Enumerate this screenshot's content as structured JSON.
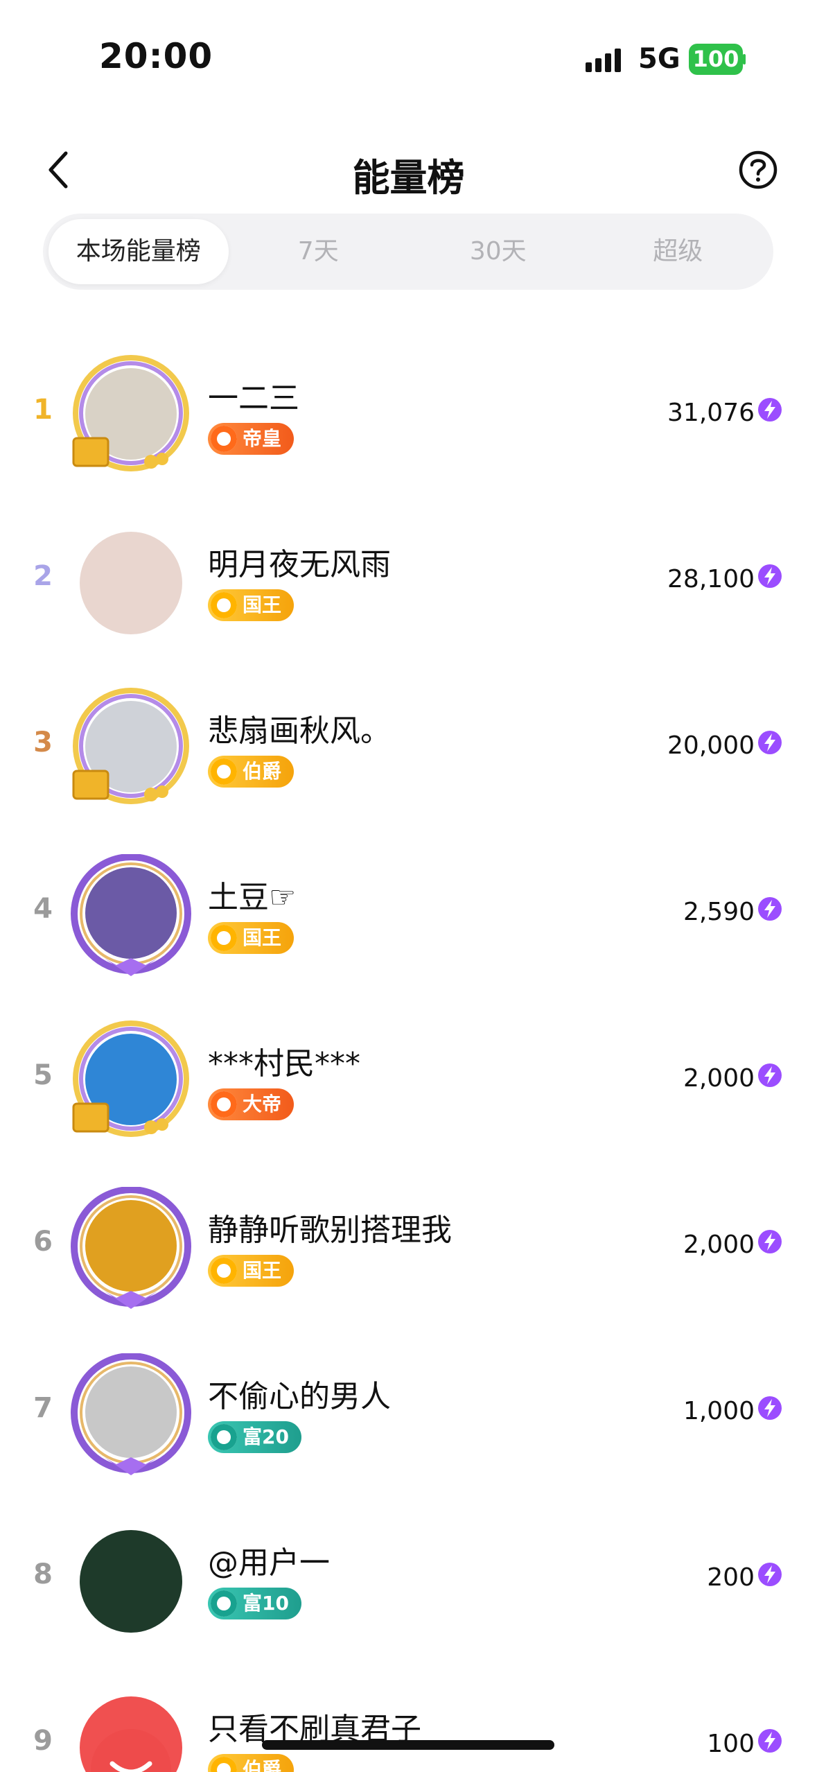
{
  "status_bar": {
    "time": "20:00",
    "network": "5G",
    "battery": "100"
  },
  "header": {
    "title": "能量榜",
    "back_icon": "chevron-left-icon",
    "help_icon": "question-circle-icon"
  },
  "tabs": [
    {
      "label": "本场能量榜",
      "active": true
    },
    {
      "label": "7天",
      "active": false
    },
    {
      "label": "30天",
      "active": false
    },
    {
      "label": "超级",
      "active": false
    }
  ],
  "colors": {
    "rank1": "#f0b429",
    "rank2": "#a9a4e8",
    "rank3": "#d48a4a",
    "rank_other": "#9b9b9b",
    "bolt": "#9b4dff",
    "tab_bg": "#f2f2f4"
  },
  "ranking": [
    {
      "rank": "1",
      "name": "一二三",
      "badge": "帝皇",
      "badge_style": "orange",
      "score": "31,076",
      "frame": "gold-card"
    },
    {
      "rank": "2",
      "name": "明月夜无风雨",
      "badge": "国王",
      "badge_style": "gold",
      "score": "28,100",
      "frame": "none"
    },
    {
      "rank": "3",
      "name": "悲扇画秋风。",
      "badge": "伯爵",
      "badge_style": "gold",
      "score": "20,000",
      "frame": "gold-card"
    },
    {
      "rank": "4",
      "name": "土豆☞",
      "badge": "国王",
      "badge_style": "gold",
      "score": "2,590",
      "frame": "purple-star"
    },
    {
      "rank": "5",
      "name": "***村民***",
      "badge": "大帝",
      "badge_style": "orange",
      "score": "2,000",
      "frame": "gold-card"
    },
    {
      "rank": "6",
      "name": "静静听歌别搭理我",
      "badge": "国王",
      "badge_style": "gold",
      "score": "2,000",
      "frame": "purple-wing"
    },
    {
      "rank": "7",
      "name": "不偷心的男人",
      "badge": "富20",
      "badge_style": "teal",
      "score": "1,000",
      "frame": "purple-wing"
    },
    {
      "rank": "8",
      "name": "@用户一",
      "badge": "富10",
      "badge_style": "teal",
      "score": "200",
      "frame": "none"
    },
    {
      "rank": "9",
      "name": "只看不刷真君子",
      "badge": "伯爵",
      "badge_style": "gold",
      "score": "100",
      "frame": "none"
    }
  ]
}
